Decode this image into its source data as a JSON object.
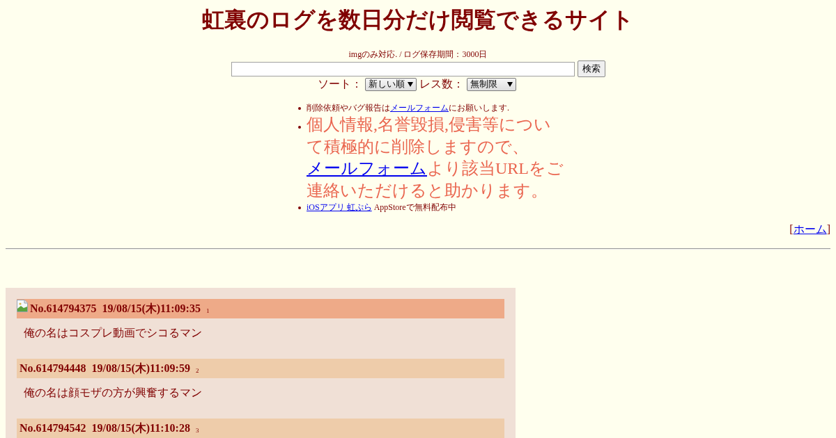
{
  "title": "虹裏のログを数日分だけ閲覧できるサイト",
  "info": "imgのみ対応. / ログ保存期間：3000日",
  "search": {
    "button": "検索"
  },
  "filters": [
    {
      "label": "ソート：",
      "value": "新しい順"
    },
    {
      "label": "レス数：",
      "value": "無制限"
    }
  ],
  "notices": [
    {
      "kind": "small",
      "parts": [
        {
          "kind": "text",
          "text": "削除依頼やバグ報告は"
        },
        {
          "kind": "link",
          "text": "メールフォーム"
        },
        {
          "kind": "text",
          "text": "にお願いします."
        }
      ]
    },
    {
      "kind": "large",
      "parts": [
        {
          "kind": "text",
          "text": "個人情報,名誉毀損,侵害等について積極的に削除しますので、"
        },
        {
          "kind": "link",
          "text": "メールフォーム"
        },
        {
          "kind": "text",
          "text": "より該当URLをご連絡いただけると助かります。"
        }
      ]
    },
    {
      "kind": "small",
      "parts": [
        {
          "kind": "link",
          "text": "iOSアプリ 虹ぷら"
        },
        {
          "kind": "text",
          "text": " AppStoreで無料配布中"
        }
      ]
    }
  ],
  "home": {
    "open": "[",
    "label": "ホーム",
    "close": "]"
  },
  "posts": [
    {
      "kind": "op",
      "number": "No.614794375",
      "date": "19/08/15(木)11:09:35",
      "index": "1",
      "body": "俺の名はコスプレ動画でシコるマン"
    },
    {
      "kind": "reply",
      "number": "No.614794448",
      "date": "19/08/15(木)11:09:59",
      "index": "2",
      "body": "俺の名は顔モザの方が興奮するマン"
    },
    {
      "kind": "reply",
      "number": "No.614794542",
      "date": "19/08/15(木)11:10:28",
      "index": "3"
    }
  ]
}
